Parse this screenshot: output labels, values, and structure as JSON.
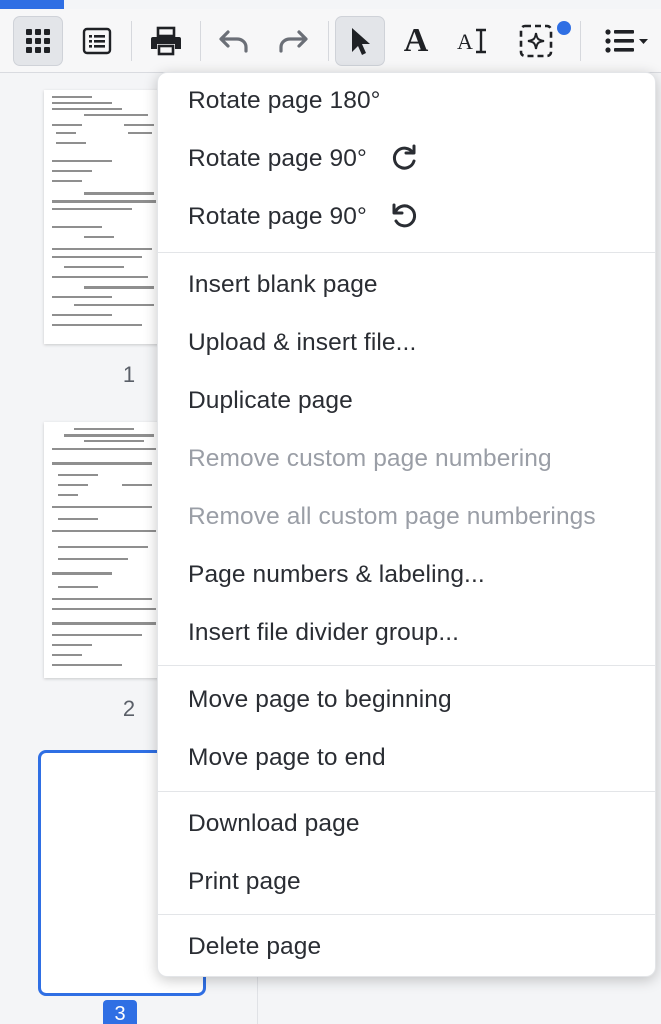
{
  "toolbar": {
    "tools": [
      {
        "name": "grid-view",
        "icon": "grid-icon",
        "active": true
      },
      {
        "name": "list-view",
        "icon": "list-view-icon",
        "active": false
      },
      {
        "name": "print",
        "icon": "printer-icon",
        "active": false
      },
      {
        "name": "undo",
        "icon": "undo-icon",
        "active": false
      },
      {
        "name": "redo",
        "icon": "redo-icon",
        "active": false
      },
      {
        "name": "select",
        "icon": "cursor-icon",
        "active": true
      },
      {
        "name": "text",
        "icon": "text-icon",
        "active": false
      },
      {
        "name": "text-edit",
        "icon": "text-cursor-icon",
        "active": false
      },
      {
        "name": "ai-select",
        "icon": "sparkle-select-icon",
        "active": false
      },
      {
        "name": "more-menu",
        "icon": "list-menu-icon",
        "active": false
      }
    ],
    "text_tool_glyph": "A",
    "text_edit_glyph": "A"
  },
  "sidebar": {
    "pages": [
      {
        "number": "1",
        "selected": false
      },
      {
        "number": "2",
        "selected": false
      },
      {
        "number": "3",
        "selected": true
      }
    ]
  },
  "context_menu": {
    "items": [
      {
        "label": "Rotate page 180°",
        "disabled": false,
        "icon": ""
      },
      {
        "label": "Rotate page 90°",
        "disabled": false,
        "icon": "rotate-clockwise-icon"
      },
      {
        "label": "Rotate page 90°",
        "disabled": false,
        "icon": "rotate-counterclockwise-icon"
      },
      {
        "label": "Insert blank page",
        "disabled": false,
        "icon": ""
      },
      {
        "label": "Upload & insert file...",
        "disabled": false,
        "icon": ""
      },
      {
        "label": "Duplicate page",
        "disabled": false,
        "icon": ""
      },
      {
        "label": "Remove custom page numbering",
        "disabled": true,
        "icon": ""
      },
      {
        "label": "Remove all custom page numberings",
        "disabled": true,
        "icon": ""
      },
      {
        "label": "Page numbers & labeling...",
        "disabled": false,
        "icon": ""
      },
      {
        "label": "Insert file divider group...",
        "disabled": false,
        "icon": ""
      },
      {
        "label": "Move page to beginning",
        "disabled": false,
        "icon": ""
      },
      {
        "label": "Move page to end",
        "disabled": false,
        "icon": ""
      },
      {
        "label": "Download page",
        "disabled": false,
        "icon": ""
      },
      {
        "label": "Print page",
        "disabled": false,
        "icon": ""
      },
      {
        "label": "Delete page",
        "disabled": false,
        "icon": ""
      }
    ]
  },
  "colors": {
    "accent": "#2f6fe4",
    "menu_text": "#2a2d33",
    "menu_disabled": "#9a9ea6"
  }
}
